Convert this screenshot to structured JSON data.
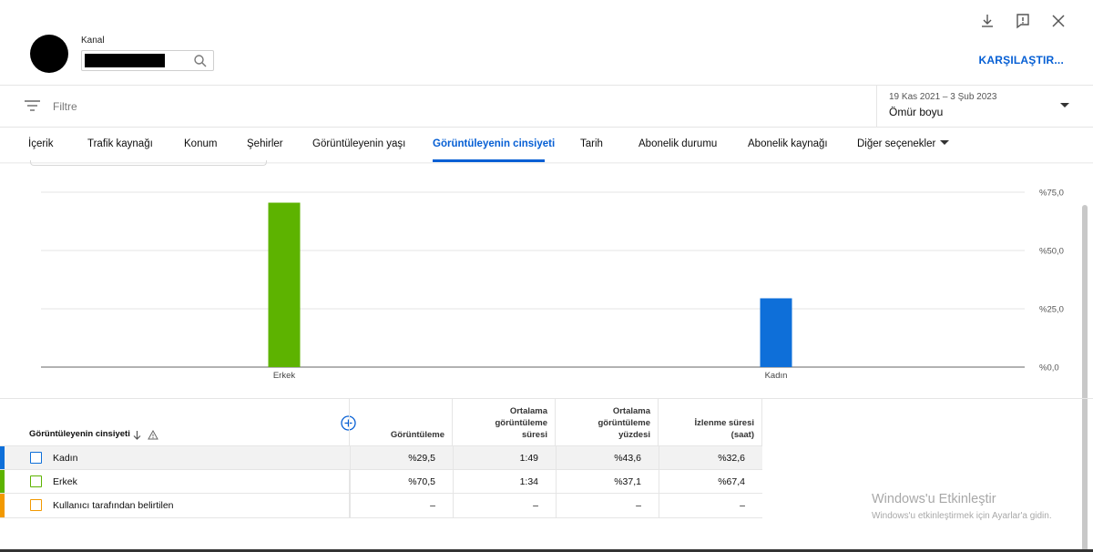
{
  "header": {
    "channel_label": "Kanal",
    "compare_button": "KARŞILAŞTIR...",
    "icons": [
      "download-icon",
      "feedback-icon",
      "close-icon"
    ]
  },
  "filter": {
    "placeholder": "Filtre",
    "date_range": "19 Kas 2021 – 3 Şub 2023",
    "date_label": "Ömür boyu"
  },
  "tabs": [
    {
      "label": "İçerik"
    },
    {
      "label": "Trafik kaynağı"
    },
    {
      "label": "Konum"
    },
    {
      "label": "Şehirler"
    },
    {
      "label": "Görüntüleyenin yaşı"
    },
    {
      "label": "Görüntüleyenin cinsiyeti",
      "active": true
    },
    {
      "label": "Tarih"
    },
    {
      "label": "Abonelik durumu"
    },
    {
      "label": "Abonelik kaynağı"
    },
    {
      "label": "Diğer seçenekler"
    }
  ],
  "chart_data": {
    "type": "bar",
    "categories": [
      "Erkek",
      "Kadın"
    ],
    "values": [
      70.5,
      29.5
    ],
    "colors": [
      "#5db300",
      "#0e6fd9"
    ],
    "ylim": [
      0,
      75
    ],
    "yticks": [
      {
        "value": 75,
        "label": "%75,0"
      },
      {
        "value": 50,
        "label": "%50,0"
      },
      {
        "value": 25,
        "label": "%25,0"
      },
      {
        "value": 0,
        "label": "%0,0"
      }
    ],
    "grid": true,
    "axis_side": "right"
  },
  "table": {
    "dimension_header": "Görüntüleyenin cinsiyeti",
    "columns": [
      [
        "Görüntüleme"
      ],
      [
        "Ortalama",
        "görüntüleme",
        "süresi"
      ],
      [
        "Ortalama",
        "görüntüleme",
        "yüzdesi"
      ],
      [
        "İzlenme süresi",
        "(saat)"
      ]
    ],
    "rows": [
      {
        "label": "Kadın",
        "color": "#0e6fd9",
        "values": [
          "%29,5",
          "1:49",
          "%43,6",
          "%32,6"
        ]
      },
      {
        "label": "Erkek",
        "color": "#5db300",
        "values": [
          "%70,5",
          "1:34",
          "%37,1",
          "%67,4"
        ]
      },
      {
        "label": "Kullanıcı tarafından belirtilen",
        "color": "#f29900",
        "values": [
          "–",
          "–",
          "–",
          "–"
        ]
      }
    ]
  },
  "watermark": {
    "title": "Windows'u Etkinleştir",
    "subtitle": "Windows'u etkinleştirmek için Ayarlar'a gidin."
  }
}
